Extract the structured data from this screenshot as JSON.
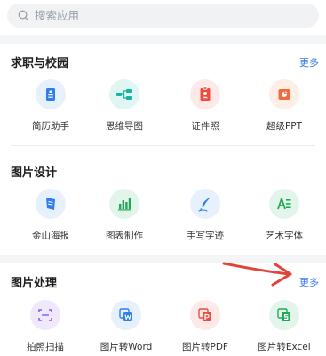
{
  "search": {
    "placeholder": "搜索应用"
  },
  "sections": [
    {
      "title": "求职与校园",
      "more": "更多",
      "items": [
        {
          "label": "简历助手",
          "icon": "resume-icon",
          "color": "#2f7ef0"
        },
        {
          "label": "思维导图",
          "icon": "mindmap-icon",
          "color": "#19b3a2"
        },
        {
          "label": "证件照",
          "icon": "id-photo-icon",
          "color": "#ef4a3d"
        },
        {
          "label": "超级PPT",
          "icon": "ppt-icon",
          "color": "#f46a3a"
        }
      ]
    },
    {
      "title": "图片设计",
      "items": [
        {
          "label": "金山海报",
          "icon": "poster-icon",
          "color": "#2f7ef0"
        },
        {
          "label": "图表制作",
          "icon": "chart-maker-icon",
          "color": "#1fa955"
        },
        {
          "label": "手写字迹",
          "icon": "handwriting-icon",
          "color": "#2f7ef0"
        },
        {
          "label": "艺术字体",
          "icon": "art-font-icon",
          "color": "#1fa955"
        }
      ]
    },
    {
      "title": "图片处理",
      "more": "更多",
      "items": [
        {
          "label": "拍照扫描",
          "icon": "scan-icon",
          "color": "#8b5cf0"
        },
        {
          "label": "图片转Word",
          "icon": "image-to-word-icon",
          "color": "#2f7ef0"
        },
        {
          "label": "图片转PDF",
          "icon": "image-to-pdf-icon",
          "color": "#ef4a3d"
        },
        {
          "label": "图片转Excel",
          "icon": "image-to-excel-icon",
          "color": "#1fa955"
        }
      ]
    }
  ],
  "annotation": {
    "arrow_color": "#e0453a"
  }
}
